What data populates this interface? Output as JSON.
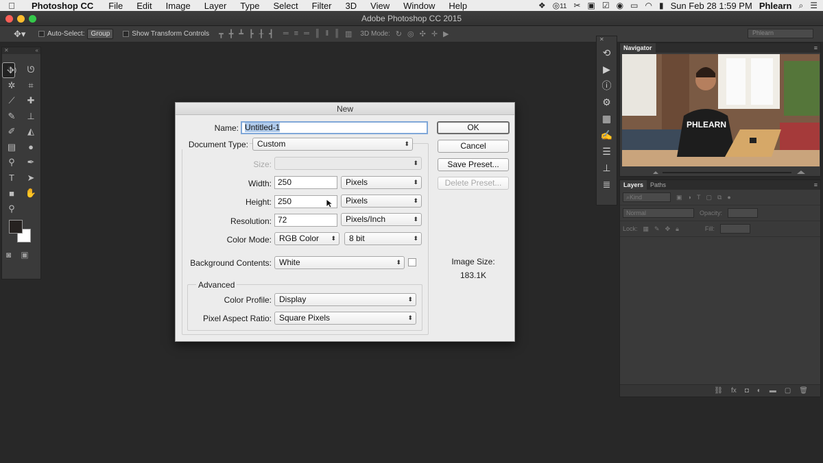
{
  "colors": {
    "accent_selection": "#b0cbeb",
    "dialog_bg": "#ececec",
    "app_bg": "#282828"
  },
  "menubar": {
    "apple_icon": "apple-icon",
    "app_name": "Photoshop CC",
    "items": [
      "File",
      "Edit",
      "Image",
      "Layer",
      "Type",
      "Select",
      "Filter",
      "3D",
      "View",
      "Window",
      "Help"
    ],
    "status_badge": "11",
    "clock": "Sun Feb 28  1:59 PM",
    "user": "Phlearn"
  },
  "window": {
    "title": "Adobe Photoshop CC 2015"
  },
  "options_bar": {
    "auto_select_label": "Auto-Select:",
    "auto_select_value": "Group",
    "show_transform_label": "Show Transform Controls",
    "mode_3d_label": "3D Mode:",
    "workspace_value": "Phlearn"
  },
  "navigator": {
    "tab": "Navigator",
    "shirt_text": "PHLEARN"
  },
  "layers": {
    "tabs": [
      "Layers",
      "Paths"
    ],
    "filter_value": "Kind",
    "blend_mode": "Normal",
    "opacity_label": "Opacity:",
    "lock_label": "Lock:",
    "fill_label": "Fill:"
  },
  "dialog": {
    "title": "New",
    "name_label": "Name:",
    "name_value": "Untitled-1",
    "document_type_label": "Document Type:",
    "document_type_value": "Custom",
    "size_label": "Size:",
    "size_value": "",
    "width_label": "Width:",
    "width_value": "250",
    "width_unit": "Pixels",
    "height_label": "Height:",
    "height_value": "250",
    "height_unit": "Pixels",
    "resolution_label": "Resolution:",
    "resolution_value": "72",
    "resolution_unit": "Pixels/Inch",
    "color_mode_label": "Color Mode:",
    "color_mode_value": "RGB Color",
    "bit_depth_value": "8 bit",
    "background_label": "Background Contents:",
    "background_value": "White",
    "advanced_label": "Advanced",
    "color_profile_label": "Color Profile:",
    "color_profile_value": "Display",
    "pixel_aspect_label": "Pixel Aspect Ratio:",
    "pixel_aspect_value": "Square Pixels",
    "ok_label": "OK",
    "cancel_label": "Cancel",
    "save_preset_label": "Save Preset...",
    "delete_preset_label": "Delete Preset...",
    "image_size_label": "Image Size:",
    "image_size_value": "183.1K"
  }
}
